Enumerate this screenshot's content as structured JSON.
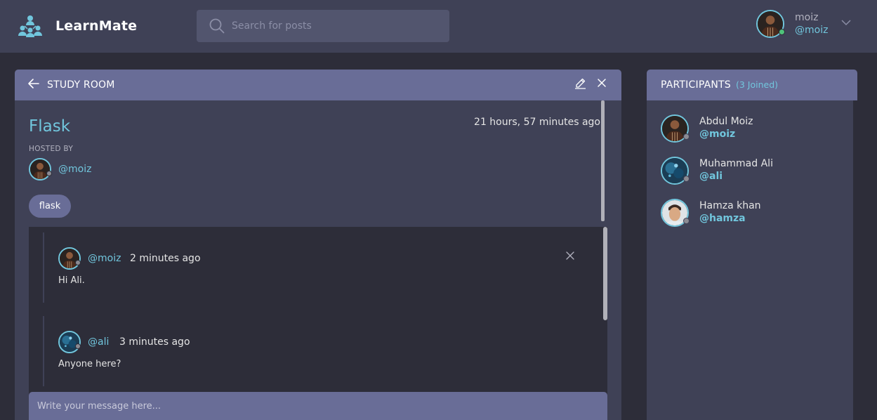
{
  "header": {
    "brand": "LearnMate",
    "search_placeholder": "Search for posts",
    "user": {
      "name": "moiz",
      "handle": "@moiz"
    }
  },
  "room": {
    "section_title": "STUDY ROOM",
    "name": "Flask",
    "created_ago": "21 hours, 57 minutes ago",
    "hosted_by_label": "HOSTED BY",
    "host_handle": "@moiz",
    "topic": "flask",
    "messages": [
      {
        "handle": "@moiz",
        "time": "2 minutes ago",
        "body": "Hi Ali."
      },
      {
        "handle": "@ali",
        "time": "3 minutes ago",
        "body": "Anyone here?"
      }
    ],
    "composer_placeholder": "Write your message here..."
  },
  "participants": {
    "title": "PARTICIPANTS",
    "count_label": "(3 Joined)",
    "items": [
      {
        "name": "Abdul Moiz",
        "handle": "@moiz"
      },
      {
        "name": "Muhammad Ali",
        "handle": "@ali"
      },
      {
        "name": "Hamza khan",
        "handle": "@hamza"
      }
    ]
  },
  "colors": {
    "accent": "#71c6dd",
    "panel": "#3f4156",
    "header_bar": "#696d97",
    "background": "#2d2d39",
    "online": "#4fc27a",
    "offline": "#8b8b93"
  },
  "icons": [
    "logo-icon",
    "search-icon",
    "chevron-down-icon",
    "arrow-left-icon",
    "edit-icon",
    "close-icon"
  ]
}
